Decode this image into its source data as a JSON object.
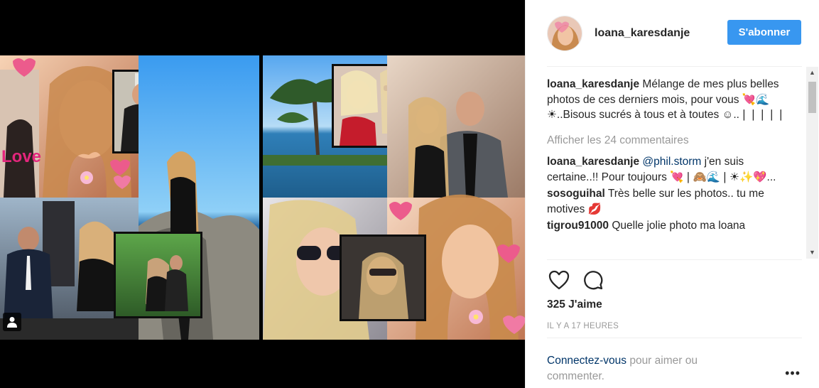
{
  "header": {
    "username": "loana_karesdanje",
    "follow_label": "S'abonner"
  },
  "caption": {
    "username": "loana_karesdanje",
    "text": "Mélange de mes plus belles photos de ces derniers mois, pour vous 💘🌊☀..Bisous sucrés à tous et à toutes ☺..❘❘❘❘❘"
  },
  "view_all_label": "Afficher les 24 commentaires",
  "comments": [
    {
      "username": "loana_karesdanje",
      "mention": "@phil.storm",
      "text": " j'en suis certaine..!! Pour toujours 💘❘🙈🌊❘☀✨💖..."
    },
    {
      "username": "sosoguihal",
      "mention": "",
      "text": "Très belle sur les photos.. tu me motives 💋"
    },
    {
      "username": "tigrou91000",
      "mention": "",
      "text": "Quelle jolie photo ma loana"
    }
  ],
  "likes": "325 J'aime",
  "time": "IL Y A 17 HEURES",
  "login": {
    "link": "Connectez-vous",
    "text": " pour aimer ou commenter."
  },
  "media": {
    "overlay_text": "Love"
  },
  "icons": [
    "heart-icon",
    "comment-icon",
    "more-icon",
    "user-tag-icon"
  ],
  "colors": {
    "follow_button": "#3897f0",
    "link": "#003569",
    "muted": "#999999"
  }
}
